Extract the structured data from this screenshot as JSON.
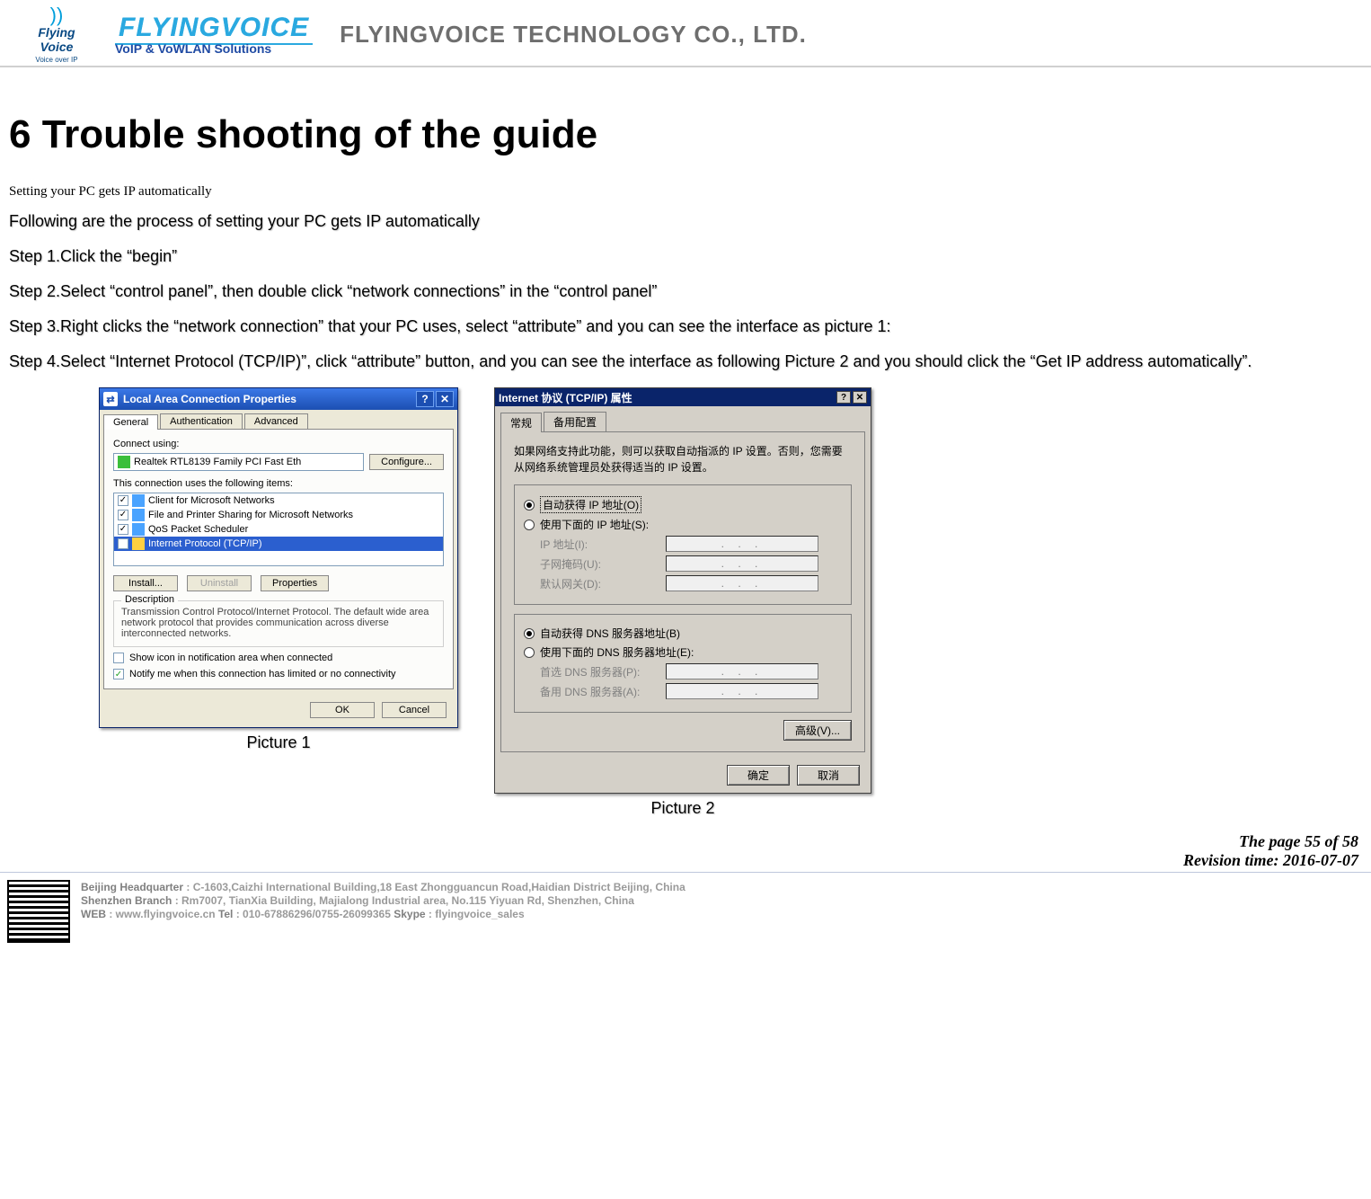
{
  "header": {
    "logo_word_top": "Flying",
    "logo_word_bottom": "Voice",
    "logo_sub": "Voice over IP",
    "brand": "FLYINGVOICE",
    "tagline": "VoIP & VoWLAN Solutions",
    "company": "FLYINGVOICE TECHNOLOGY CO., LTD."
  },
  "section_title": "6  Trouble shooting of the guide",
  "intro": "Setting your PC gets IP automatically",
  "lead": "Following are the process of setting your PC gets IP automatically",
  "steps": {
    "s1": "Step 1.Click the “begin”",
    "s2": "Step 2.Select “control panel”, then double click “network connections” in the “control panel”",
    "s3": "Step 3.Right clicks the “network connection” that your PC uses, select “attribute” and you can see the interface as picture 1:",
    "s4": "Step 4.Select “Internet Protocol (TCP/IP)”, click “attribute” button, and you can see the interface as following Picture 2   and you should click the “Get IP address automatically”."
  },
  "picture1": {
    "title": "Local Area Connection Properties",
    "tabs": {
      "general": "General",
      "auth": "Authentication",
      "adv": "Advanced"
    },
    "connect_using": "Connect using:",
    "nic": "Realtek RTL8139 Family PCI Fast Eth",
    "configure": "Configure...",
    "items_label": "This connection uses the following items:",
    "items": {
      "i1": "Client for Microsoft Networks",
      "i2": "File and Printer Sharing for Microsoft Networks",
      "i3": "QoS Packet Scheduler",
      "i4": "Internet Protocol (TCP/IP)"
    },
    "install": "Install...",
    "uninstall": "Uninstall",
    "properties": "Properties",
    "desc_legend": "Description",
    "desc_text": "Transmission Control Protocol/Internet Protocol. The default wide area network protocol that provides communication across diverse interconnected networks.",
    "chk_show": "Show icon in notification area when connected",
    "chk_notify": "Notify me when this connection has limited or no connectivity",
    "ok": "OK",
    "cancel": "Cancel",
    "help_icon": "?",
    "close_icon": "✕",
    "caption": "Picture 1"
  },
  "picture2": {
    "title": "Internet 协议 (TCP/IP) 属性",
    "tab_general": "常规",
    "tab_backup": "备用配置",
    "info": "如果网络支持此功能，则可以获取自动指派的 IP 设置。否则，您需要从网络系统管理员处获得适当的 IP 设置。",
    "r_auto_ip": "自动获得 IP 地址(O)",
    "r_use_ip": "使用下面的 IP 地址(S):",
    "ip_label": "IP 地址(I):",
    "mask_label": "子网掩码(U):",
    "gw_label": "默认网关(D):",
    "r_auto_dns": "自动获得 DNS 服务器地址(B)",
    "r_use_dns": "使用下面的 DNS 服务器地址(E):",
    "dns1_label": "首选 DNS 服务器(P):",
    "dns2_label": "备用 DNS 服务器(A):",
    "dots": ".   .   .",
    "advanced": "高级(V)...",
    "ok": "确定",
    "cancel": "取消",
    "help_icon": "?",
    "close_icon": "✕",
    "caption": "Picture 2"
  },
  "page_info": {
    "l1": "The page 55 of 58",
    "l2": "Revision time: 2016-07-07"
  },
  "footer": {
    "l1_label": "Beijing Headquarter  ",
    "l1_val": ": C-1603,Caizhi International Building,18 East Zhongguancun Road,Haidian District Beijing, China",
    "l2_label": "Shenzhen Branch ",
    "l2_val": ": Rm7007, TianXia Building, Majialong Industrial area, No.115 Yiyuan Rd, Shenzhen, China",
    "l3_label": "WEB ",
    "l3_val": ": www.flyingvoice.cn",
    "l3b_label": "   Tel ",
    "l3b_val": ": 010-67886296/0755-26099365",
    "l3c_label": "   Skype ",
    "l3c_val": ": flyingvoice_sales"
  }
}
